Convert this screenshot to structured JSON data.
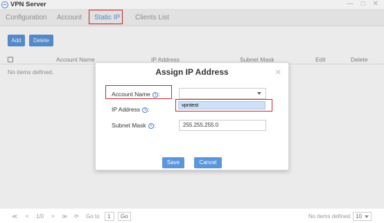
{
  "window": {
    "title": "VPN Server",
    "controls": "— □ ✕"
  },
  "tabs": [
    {
      "label": "Configuration"
    },
    {
      "label": "Account"
    },
    {
      "label": "Static IP"
    },
    {
      "label": "Clients List"
    }
  ],
  "toolbar": {
    "add_label": "Add",
    "delete_label": "Delete"
  },
  "table": {
    "columns": [
      "Account Name",
      "IP Address",
      "Subnet Mask",
      "Edit",
      "Delete"
    ],
    "empty_text": "No items defined."
  },
  "dialog": {
    "title": "Assign IP Address",
    "close": "✕",
    "account_name_label": "Account Name",
    "account_name_value": "",
    "account_name_option": "vpntest",
    "ip_address_label": "IP Address",
    "subnet_mask_label": "Subnet Mask",
    "subnet_mask_value": "255.255.255.0",
    "info_glyph": "i",
    "save_label": "Save",
    "cancel_label": "Cancel"
  },
  "pagination": {
    "first": "≪",
    "prev": "<",
    "page_info": "1/0",
    "next": ">",
    "last": "≫",
    "refresh": "⟳",
    "goto_label": "Go to",
    "goto_value": "1",
    "go_label": "Go",
    "status": "No items defined.",
    "page_size": "10"
  },
  "colors": {
    "accent": "#5b95dc",
    "highlight": "#d0232a",
    "active_tab": "#5b8fd6"
  }
}
